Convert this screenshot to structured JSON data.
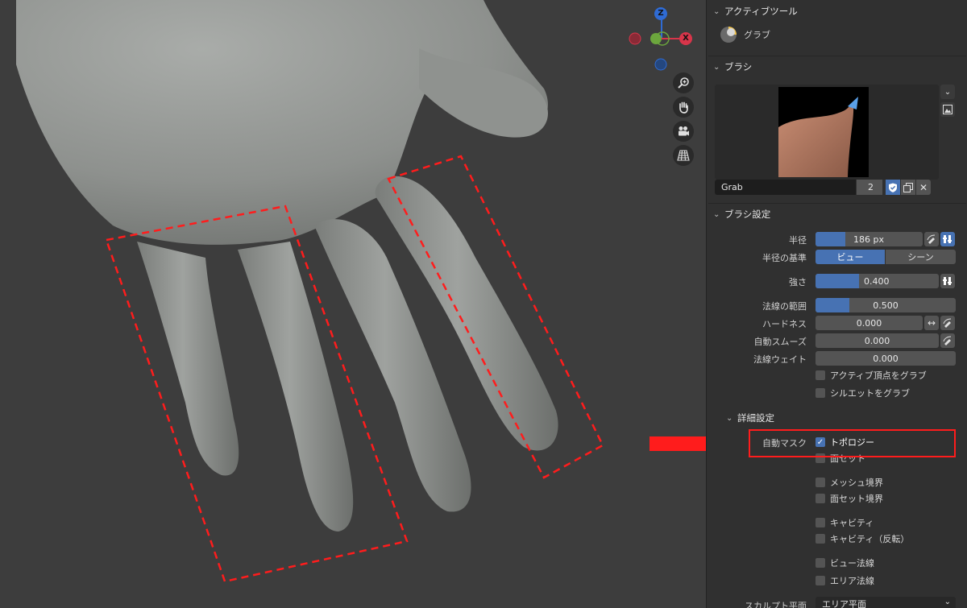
{
  "gizmo": {
    "z_label": "Z",
    "x_label": "X",
    "colors": {
      "z": "#2f6bd4",
      "x": "#d8354a",
      "y": "#6ca63d"
    }
  },
  "viewport_tools": [
    {
      "name": "zoom-icon"
    },
    {
      "name": "hand-icon"
    },
    {
      "name": "camera-icon"
    },
    {
      "name": "grid-icon"
    }
  ],
  "active_tool": {
    "header": "アクティブツール",
    "tool_name": "グラブ"
  },
  "brush": {
    "header": "ブラシ",
    "name": "Grab",
    "users": "2"
  },
  "brush_settings": {
    "header": "ブラシ設定",
    "radius_label": "半径",
    "radius_value": "186 px",
    "radius_fill": 0.28,
    "radius_unit_label": "半径の基準",
    "radius_unit_options": [
      "ビュー",
      "シーン"
    ],
    "radius_unit_selected": "ビュー",
    "strength_label": "強さ",
    "strength_value": "0.400",
    "strength_fill": 0.35,
    "normal_radius_label": "法線の範囲",
    "normal_radius_value": "0.500",
    "normal_radius_fill": 0.24,
    "hardness_label": "ハードネス",
    "hardness_value": "0.000",
    "auto_smooth_label": "自動スムーズ",
    "auto_smooth_value": "0.000",
    "normal_weight_label": "法線ウェイト",
    "normal_weight_value": "0.000",
    "grab_active_vertex": "アクティブ頂点をグラブ",
    "grab_silhouette": "シルエットをグラブ"
  },
  "advanced": {
    "header": "詳細設定",
    "automask_label": "自動マスク",
    "topology": "トポロジー",
    "face_sets": "面セット",
    "mesh_boundary": "メッシュ境界",
    "face_set_boundary": "面セット境界",
    "cavity": "キャビティ",
    "cavity_inverted": "キャビティ（反転）",
    "view_normal": "ビュー法線",
    "area_normal": "エリア法線",
    "sculpt_plane_label": "スカルプト平面",
    "sculpt_plane_value": "エリア平面"
  },
  "colors": {
    "accent": "#4772b3",
    "annotation_red": "#ff1c1c"
  }
}
